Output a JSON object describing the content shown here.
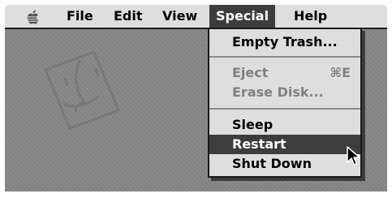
{
  "menubar": {
    "apple_icon": "apple-icon",
    "items": [
      {
        "label": "File"
      },
      {
        "label": "Edit"
      },
      {
        "label": "View"
      },
      {
        "label": "Special",
        "active": true
      },
      {
        "label": "Help"
      }
    ]
  },
  "special_menu": {
    "items": [
      {
        "label": "Empty Trash...",
        "enabled": true
      },
      {
        "label": "Eject",
        "shortcut": "⌘E",
        "enabled": false
      },
      {
        "label": "Erase Disk...",
        "enabled": false
      },
      {
        "label": "Sleep",
        "enabled": true
      },
      {
        "label": "Restart",
        "enabled": true,
        "highlighted": true
      },
      {
        "label": "Shut Down",
        "enabled": true
      }
    ]
  },
  "desktop": {
    "background_icon": "finder-face-icon"
  },
  "cursor_icon": "arrow-pointer-icon",
  "colors": {
    "desktop": "#878787",
    "menubar": "#dedede",
    "highlight": "#3d3d3d",
    "disabled_text": "#808080"
  }
}
